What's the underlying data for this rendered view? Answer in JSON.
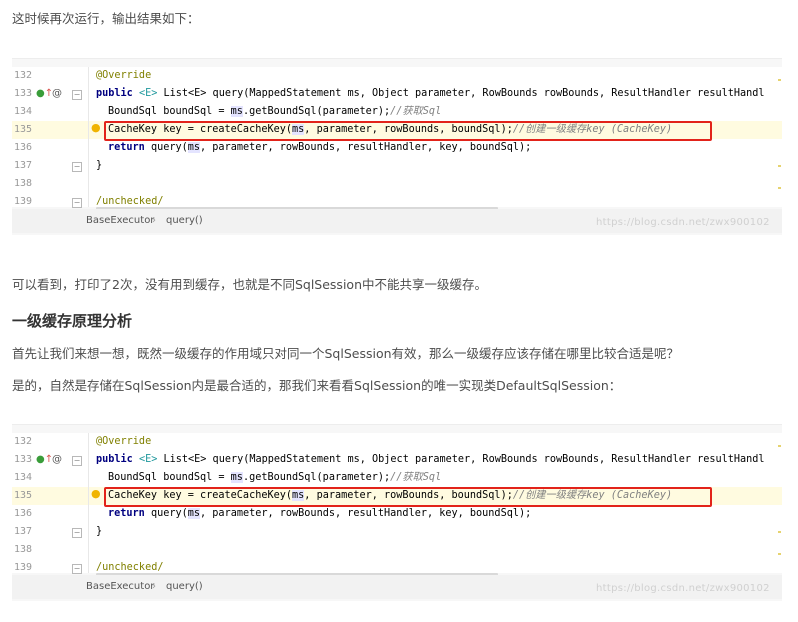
{
  "intro_text": "这时候再次运行，输出结果如下：",
  "para1": "可以看到，打印了2次，没有用到缓存，也就是不同SqlSession中不能共享一级缓存。",
  "heading": "一级缓存原理分析",
  "para2": "首先让我们来想一想，既然一级缓存的作用域只对同一个SqlSession有效，那么一级缓存应该存储在哪里比较合适是呢？",
  "para3": "是的，自然是存储在SqlSession内是最合适的，那我们来看看SqlSession的唯一实现类DefaultSqlSession：",
  "code": {
    "line_numbers": [
      "132",
      "133",
      "134",
      "135",
      "136",
      "137",
      "138",
      "139"
    ],
    "annotation": "@Override",
    "sig_public": "public",
    "sig_generic": "<E>",
    "sig_rest": " List<E> query(MappedStatement ms, Object parameter, RowBounds rowBounds, ResultHandler resultHandl",
    "line3_a": "BoundSql boundSql = ",
    "line3_ms": "ms",
    "line3_b": ".getBoundSql(parameter);",
    "line3_cm": "//获取Sql",
    "line4_a": "CacheKey key = createCacheKey(",
    "line4_ms": "ms",
    "line4_b": ", parameter, rowBounds, boundSql);",
    "line4_cm": "//创建一级缓存key (CacheKey)",
    "line5_kw": "return",
    "line5_a": " query(",
    "line5_ms": "ms",
    "line5_b": ", parameter, rowBounds, resultHandler, key, boundSql);",
    "line6": "}",
    "line8": "/unchecked/"
  },
  "statusbar": {
    "crumb1": "BaseExecutor",
    "separator": "›",
    "crumb2": "query()"
  },
  "watermark": "https://blog.csdn.net/zwx900102",
  "colors": {
    "highlight_box": "#e2231a",
    "keyword": "#000080",
    "annotation": "#808000",
    "comment": "#808080"
  }
}
